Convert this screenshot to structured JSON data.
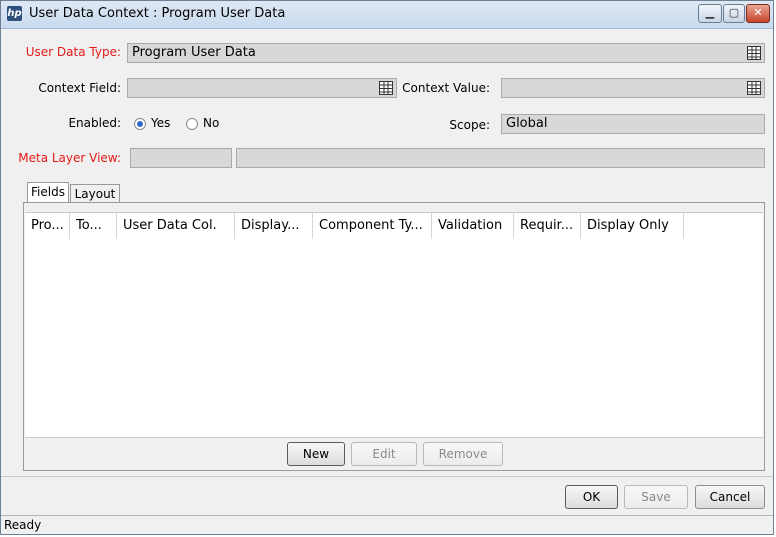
{
  "window": {
    "title": "User Data Context : Program User Data",
    "icon": "hp-app-icon",
    "controls": {
      "minimize": "▁",
      "maximize": "▢",
      "close": "✕"
    }
  },
  "form": {
    "user_data_type_label": "User Data Type:",
    "user_data_type_value": "Program User Data",
    "context_field_label": "Context Field:",
    "context_field_value": "",
    "context_value_label": "Context Value:",
    "context_value_value": "",
    "enabled_label": "Enabled:",
    "enabled_yes": "Yes",
    "enabled_no": "No",
    "enabled_selected": "Yes",
    "scope_label": "Scope:",
    "scope_value": "Global",
    "meta_layer_view_label": "Meta Layer View:",
    "meta_layer_view_value_1": "",
    "meta_layer_view_value_2": ""
  },
  "tabs": [
    {
      "label": "Fields",
      "active": true
    },
    {
      "label": "Layout",
      "active": false
    }
  ],
  "table": {
    "columns": [
      "Pro...",
      "To...",
      "User Data Col.",
      "Display...",
      "Component Ty...",
      "Validation",
      "Requir...",
      "Display Only"
    ],
    "rows": []
  },
  "panel_buttons": {
    "new": "New",
    "edit": "Edit",
    "remove": "Remove"
  },
  "dialog_buttons": {
    "ok": "OK",
    "save": "Save",
    "cancel": "Cancel"
  },
  "status": "Ready",
  "colors": {
    "required_label": "#e41b17",
    "field_bg": "#d8d8d8",
    "window_bg": "#f0f0f0"
  }
}
